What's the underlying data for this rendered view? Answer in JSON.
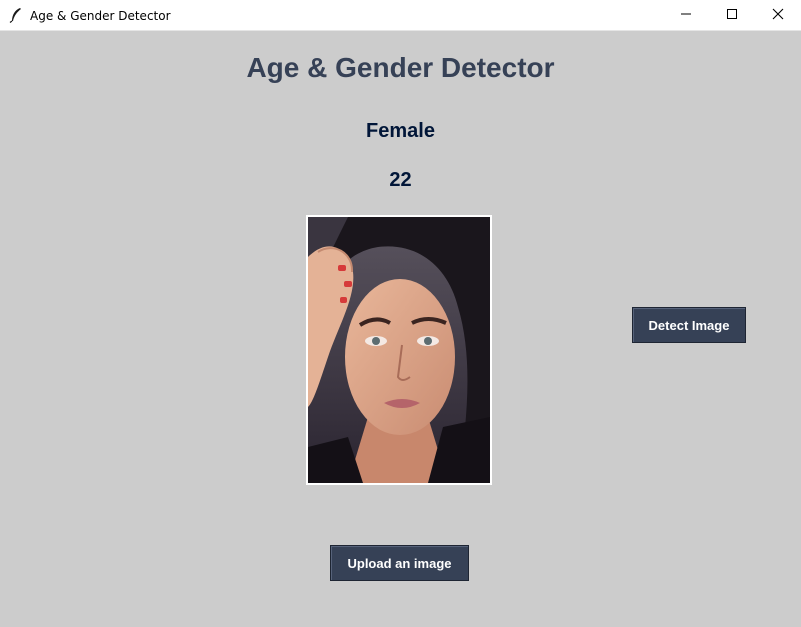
{
  "window": {
    "title": "Age & Gender Detector",
    "icons": [
      "feather-icon",
      "minimize-icon",
      "maximize-icon",
      "close-icon"
    ]
  },
  "main": {
    "heading": "Age & Gender Detector",
    "gender": "Female",
    "age": "22",
    "photo_description_icon": "face-photo"
  },
  "buttons": {
    "detect_label": "Detect Image",
    "upload_label": "Upload an image"
  },
  "colors": {
    "background": "#cccccc",
    "heading": "#364156",
    "result_text": "#011638",
    "button_bg": "#364156",
    "button_text": "#ffffff"
  }
}
